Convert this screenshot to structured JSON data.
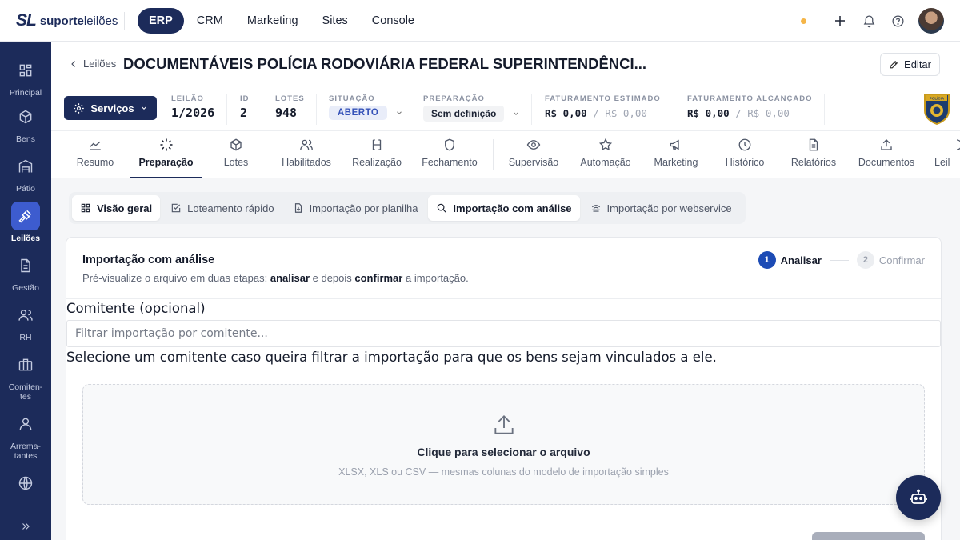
{
  "brand": {
    "mark": "SL",
    "name_bold": "suporte",
    "name_rest": "leilões"
  },
  "topnav": [
    "ERP",
    "CRM",
    "Marketing",
    "Sites",
    "Console"
  ],
  "sidebar": [
    {
      "label": "Principal",
      "icon": "grid-icon"
    },
    {
      "label": "Bens",
      "icon": "box-icon"
    },
    {
      "label": "Pátio",
      "icon": "warehouse-icon"
    },
    {
      "label": "Leilões",
      "icon": "gavel-icon",
      "active": true
    },
    {
      "label": "Gestão",
      "icon": "document-icon"
    },
    {
      "label": "RH",
      "icon": "users-icon"
    },
    {
      "label": "Comiten-\ntes",
      "icon": "briefcase-icon"
    },
    {
      "label": "Arrema-\ntantes",
      "icon": "user-icon"
    },
    {
      "label": "",
      "icon": "globe-icon"
    }
  ],
  "header": {
    "back_label": "Leilões",
    "title": "DOCUMENTÁVEIS POLÍCIA RODOVIÁRIA FEDERAL SUPERINTENDÊNCI...",
    "edit_label": "Editar"
  },
  "info": {
    "services_label": "Serviços",
    "leilao": {
      "label": "LEILÃO",
      "value": "1/2026"
    },
    "id": {
      "label": "ID",
      "value": "2"
    },
    "lotes": {
      "label": "LOTES",
      "value": "948"
    },
    "situacao": {
      "label": "SITUAÇÃO",
      "value": "ABERTO"
    },
    "preparacao": {
      "label": "PREPARAÇÃO",
      "value": "Sem definição"
    },
    "fat_estimado": {
      "label": "FATURAMENTO ESTIMADO",
      "value": "R$ 0,00",
      "sep": "/",
      "secondary": "R$ 0,00"
    },
    "fat_alcancado": {
      "label": "FATURAMENTO ALCANÇADO",
      "value": "R$ 0,00",
      "sep": "/",
      "secondary": "R$ 0,00"
    },
    "crest_text": "POLÍCIA"
  },
  "module_tabs": [
    {
      "label": "Resumo",
      "icon": "chart-icon"
    },
    {
      "label": "Preparação",
      "icon": "loader-icon",
      "active": true
    },
    {
      "label": "Lotes",
      "icon": "box-icon"
    },
    {
      "label": "Habilitados",
      "icon": "users-icon"
    },
    {
      "label": "Realização",
      "icon": "gavel-icon"
    },
    {
      "label": "Fechamento",
      "icon": "shield-icon"
    },
    {
      "label": "Supervisão",
      "icon": "eye-icon"
    },
    {
      "label": "Automação",
      "icon": "star-icon"
    },
    {
      "label": "Marketing",
      "icon": "megaphone-icon"
    },
    {
      "label": "Histórico",
      "icon": "clock-icon"
    },
    {
      "label": "Relatórios",
      "icon": "file-icon"
    },
    {
      "label": "Documentos",
      "icon": "upload-icon"
    },
    {
      "label": "Leil",
      "icon": "list-icon"
    }
  ],
  "subtabs": [
    {
      "label": "Visão geral",
      "icon": "grid-icon"
    },
    {
      "label": "Loteamento rápido",
      "icon": "check-square-icon"
    },
    {
      "label": "Importação por planilha",
      "icon": "file-import-icon"
    },
    {
      "label": "Importação com análise",
      "icon": "search-icon",
      "active": true
    },
    {
      "label": "Importação por webservice",
      "icon": "webservice-icon"
    }
  ],
  "card": {
    "title": "Importação com análise",
    "desc_1": "Pré-visualize o arquivo em duas etapas: ",
    "desc_b1": "analisar",
    "desc_2": " e depois ",
    "desc_b2": "confirmar",
    "desc_3": " a importação.",
    "steps": [
      {
        "n": "1",
        "label": "Analisar"
      },
      {
        "n": "2",
        "label": "Confirmar"
      }
    ]
  },
  "form": {
    "label": "Comitente (opcional)",
    "placeholder": "Filtrar importação por comitente...",
    "help": "Selecione um comitente caso queira filtrar a importação para que os bens sejam vinculados a ele."
  },
  "dropzone": {
    "title": "Clique para selecionar o arquivo",
    "subtitle": "XLSX, XLS ou CSV — mesmas colunas do modelo de importação simples"
  },
  "colors": {
    "primary": "#1c2b5a",
    "accent": "#3d5ccf",
    "badge": "#e9edf9"
  }
}
